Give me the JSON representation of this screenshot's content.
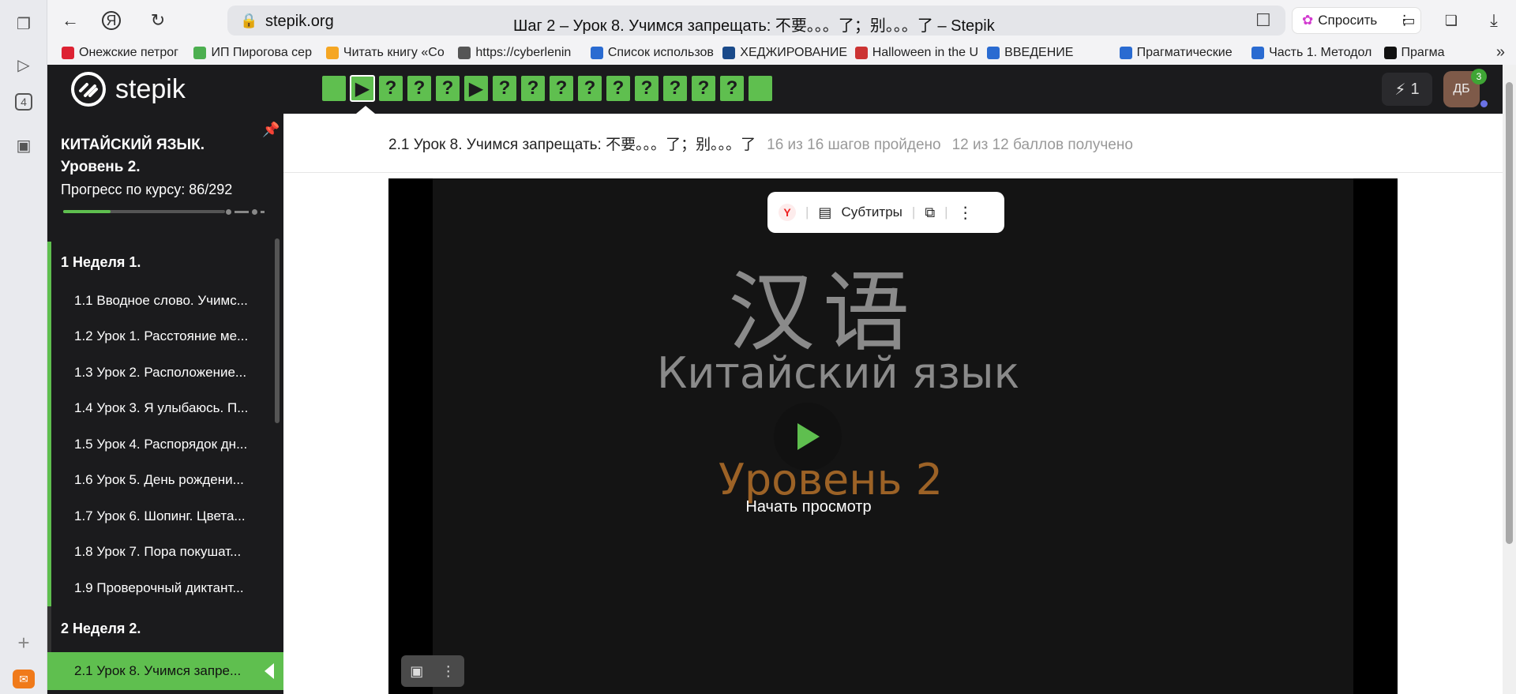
{
  "browser": {
    "url": "stepik.org",
    "title": "Шаг 2 – Урок 8. Учимся запрещать: 不要。。。了；别。。。了 – Stepik",
    "ask_label": "Спросить",
    "bookmarks": [
      {
        "label": "Онежские петрог",
        "color": "#d23"
      },
      {
        "label": "ИП Пирогова сер",
        "color": "#4caf50"
      },
      {
        "label": "Читать книгу «Со",
        "color": "#f5a623"
      },
      {
        "label": "https://cyberlenin",
        "color": "#555"
      },
      {
        "label": "Список использов",
        "color": "#2a6bd1"
      },
      {
        "label": "ХЕДЖИРОВАНИЕ",
        "color": "#1a4a8a"
      },
      {
        "label": "Halloween in the U",
        "color": "#c33"
      },
      {
        "label": "ВВЕДЕНИЕ",
        "color": "#2a6bd1"
      },
      {
        "label": "Прагматические",
        "color": "#2a6bd1"
      },
      {
        "label": "Часть 1. Методол",
        "color": "#2a6bd1"
      },
      {
        "label": "Прагма",
        "color": "#111"
      }
    ],
    "os_badge": "4"
  },
  "header": {
    "logo_text": "stepik",
    "steps": [
      "",
      "▶",
      "?",
      "?",
      "?",
      "▶",
      "?",
      "?",
      "?",
      "?",
      "?",
      "?",
      "?",
      "?",
      "?",
      ""
    ],
    "energy": "1",
    "avatar": "ДБ",
    "avatar_badge": "3"
  },
  "course": {
    "title": "КИТАЙСКИЙ ЯЗЫК. Уровень 2.",
    "progress_label": "Прогресс по курсу:  86/292",
    "progress_fraction": 0.294,
    "week1": "1  Неделя 1.",
    "items": [
      "1.1  Вводное слово. Учимс...",
      "1.2  Урок 1. Расстояние ме...",
      "1.3  Урок 2. Расположение...",
      "1.4  Урок 3. Я улыбаюсь. П...",
      "1.5  Урок 4. Распорядок дн...",
      "1.6  Урок 5. День рождени...",
      "1.7  Урок 6. Шопинг. Цвета...",
      "1.8  Урок 7. Пора покушат...",
      "1.9  Проверочный диктант..."
    ],
    "week2": "2  Неделя 2.",
    "active_item": "2.1  Урок 8. Учимся запре..."
  },
  "lesson": {
    "title": "2.1 Урок 8. Учимся запрещать: 不要。。。了；别。。。了",
    "steps_done": "16 из 16 шагов пройдено",
    "points": "12 из 12 баллов  получено"
  },
  "video": {
    "subtitles_label": "Субтитры",
    "hanzi": "汉语",
    "ru_title": "Китайский язык",
    "level": "Уровень 2",
    "start_label": "Начать просмотр"
  }
}
